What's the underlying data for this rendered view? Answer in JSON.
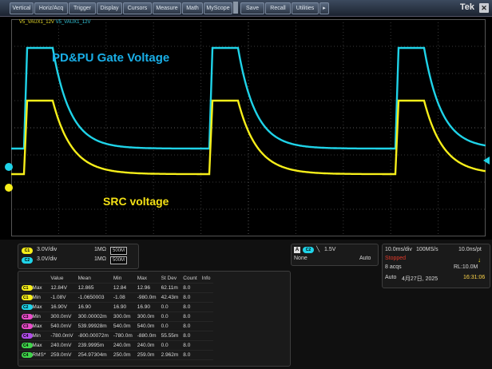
{
  "menu": {
    "items": [
      "Vertical",
      "Horiz/Acq",
      "Trigger",
      "Display",
      "Cursors",
      "Measure",
      "Math",
      "MyScope",
      "Save",
      "Recall",
      "Utilities"
    ],
    "brand": "Tek"
  },
  "waveforms": {
    "channel_names": [
      "V5_VAUX1_12V",
      "V5_VAUX1_12V"
    ],
    "gate_label": "PD&PU Gate Voltage",
    "src_label": "SRC voltage",
    "gate_color": "#1fd3e8",
    "src_color": "#f6ee1a"
  },
  "channels": [
    {
      "badge": "C1",
      "scale": "3.0V/div",
      "impedance": "1MΩ",
      "bw": "500M",
      "color": "#f6ee1a"
    },
    {
      "badge": "C2",
      "scale": "3.0V/div",
      "impedance": "1MΩ",
      "bw": "500M",
      "color": "#1fd3e8"
    }
  ],
  "trigger": {
    "source": "C2",
    "level": "1.5V",
    "coupling": "None",
    "mode": "Auto"
  },
  "acq": {
    "timebase": "10.0ms/div",
    "sample_rate": "100MS/s",
    "resolution": "10.0ns/pt",
    "state": "Stopped",
    "acqs": "8 acqs",
    "record_length": "RL:10.0M",
    "mode": "Auto",
    "date": "4月27日, 2025",
    "time": "16:31:06"
  },
  "measurements": {
    "headers": [
      "",
      "Value",
      "Mean",
      "Min",
      "Max",
      "St Dev",
      "Count",
      "Info"
    ],
    "rows": [
      {
        "badge": "C1",
        "color": "#f6ee1a",
        "name": "Max",
        "value": "12.84V",
        "mean": "12.865",
        "min": "12.84",
        "max": "12.96",
        "stdev": "62.11m",
        "count": "8.0"
      },
      {
        "badge": "C1",
        "color": "#f6ee1a",
        "name": "Min",
        "value": "-1.08V",
        "mean": "-1.0650003",
        "min": "-1.08",
        "max": "-980.0m",
        "stdev": "42.43m",
        "count": "8.0"
      },
      {
        "badge": "C2",
        "color": "#1fd3e8",
        "name": "Max",
        "value": "16.90V",
        "mean": "16.90",
        "min": "16.90",
        "max": "16.90",
        "stdev": "0.0",
        "count": "8.0"
      },
      {
        "badge": "C3",
        "color": "#e84cc8",
        "name": "Min",
        "value": "300.0mV",
        "mean": "300.00002m",
        "min": "300.0m",
        "max": "300.0m",
        "stdev": "0.0",
        "count": "8.0"
      },
      {
        "badge": "C3",
        "color": "#e84cc8",
        "name": "Max",
        "value": "540.0mV",
        "mean": "539.99928m",
        "min": "540.0m",
        "max": "540.0m",
        "stdev": "0.0",
        "count": "8.0"
      },
      {
        "badge": "C4",
        "color": "#b04ce8",
        "name": "Min",
        "value": "-780.0mV",
        "mean": "-800.00072m",
        "min": "-780.0m",
        "max": "-880.0m",
        "stdev": "55.55m",
        "count": "8.0"
      },
      {
        "badge": "C4",
        "color": "#3fd34a",
        "name": "Max",
        "value": "240.0mV",
        "mean": "239.9995m",
        "min": "240.0m",
        "max": "240.0m",
        "stdev": "0.0",
        "count": "8.0"
      },
      {
        "badge": "C4",
        "color": "#3fd34a",
        "name": "RMS*",
        "value": "259.0mV",
        "mean": "254.97304m",
        "min": "250.0m",
        "max": "259.0m",
        "stdev": "2.962m",
        "count": "8.0"
      }
    ]
  }
}
